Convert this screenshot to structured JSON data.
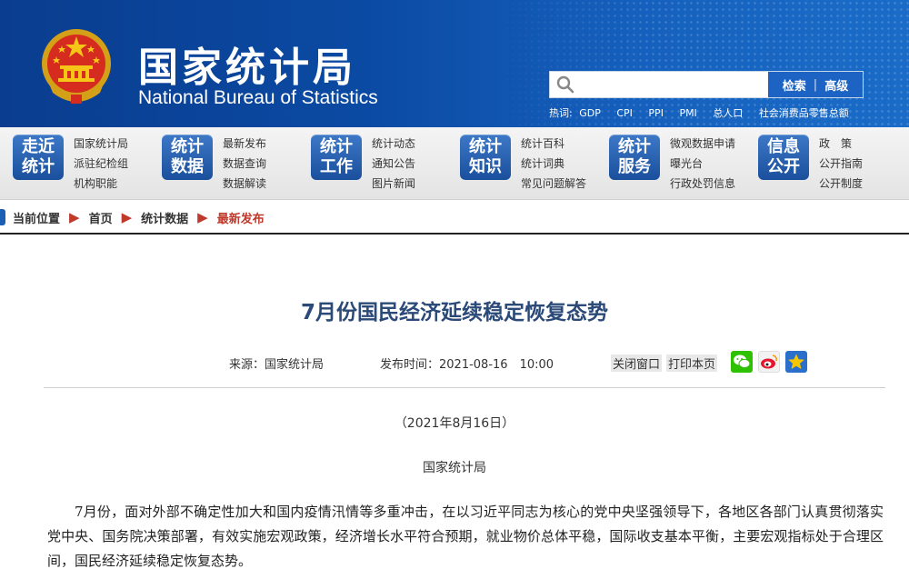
{
  "header": {
    "logo_cn": "国家统计局",
    "logo_en": "National Bureau of Statistics",
    "search": {
      "placeholder": "",
      "search_label": "检索",
      "separator": "|",
      "advanced_label": "高级"
    },
    "hotwords_label": "热词:",
    "hotwords": [
      "GDP",
      "CPI",
      "PPI",
      "PMI",
      "总人口",
      "社会消费品零售总额"
    ]
  },
  "nav": [
    {
      "badge": [
        "走近",
        "统计"
      ],
      "links": [
        "国家统计局",
        "派驻纪检组",
        "机构职能"
      ]
    },
    {
      "badge": [
        "统计",
        "数据"
      ],
      "links": [
        "最新发布",
        "数据查询",
        "数据解读"
      ]
    },
    {
      "badge": [
        "统计",
        "工作"
      ],
      "links": [
        "统计动态",
        "通知公告",
        "图片新闻"
      ]
    },
    {
      "badge": [
        "统计",
        "知识"
      ],
      "links": [
        "统计百科",
        "统计词典",
        "常见问题解答"
      ]
    },
    {
      "badge": [
        "统计",
        "服务"
      ],
      "links": [
        "微观数据申请",
        "曝光台",
        "行政处罚信息"
      ]
    },
    {
      "badge": [
        "信息",
        "公开"
      ],
      "links": [
        "政　策",
        "公开指南",
        "公开制度"
      ]
    }
  ],
  "breadcrumb": {
    "label": "当前位置",
    "items": [
      "首页",
      "统计数据",
      "最新发布"
    ],
    "arrow": "▶"
  },
  "article": {
    "title": "7月份国民经济延续稳定恢复态势",
    "source_label": "来源：",
    "source": "国家统计局",
    "time_label": "发布时间：",
    "time": "2021-08-16　10:00",
    "close_label": "关闭窗口",
    "print_label": "打印本页",
    "share_icons": [
      "wechat-icon",
      "weibo-icon",
      "favorite-star-icon"
    ],
    "date": "（2021年8月16日）",
    "org": "国家统计局",
    "paragraph": "7月份，面对外部不确定性加大和国内疫情汛情等多重冲击，在以习近平同志为核心的党中央坚强领导下，各地区各部门认真贯彻落实党中央、国务院决策部署，有效实施宏观政策，经济增长水平符合预期，就业物价总体平稳，国际收支基本平衡，主要宏观指标处于合理区间，国民经济延续稳定恢复态势。"
  },
  "colors": {
    "header_blue": "#0b4aa3",
    "badge_blue": "#1a4f9c",
    "title_blue": "#2b4a78",
    "crumb_red": "#c0392b"
  }
}
